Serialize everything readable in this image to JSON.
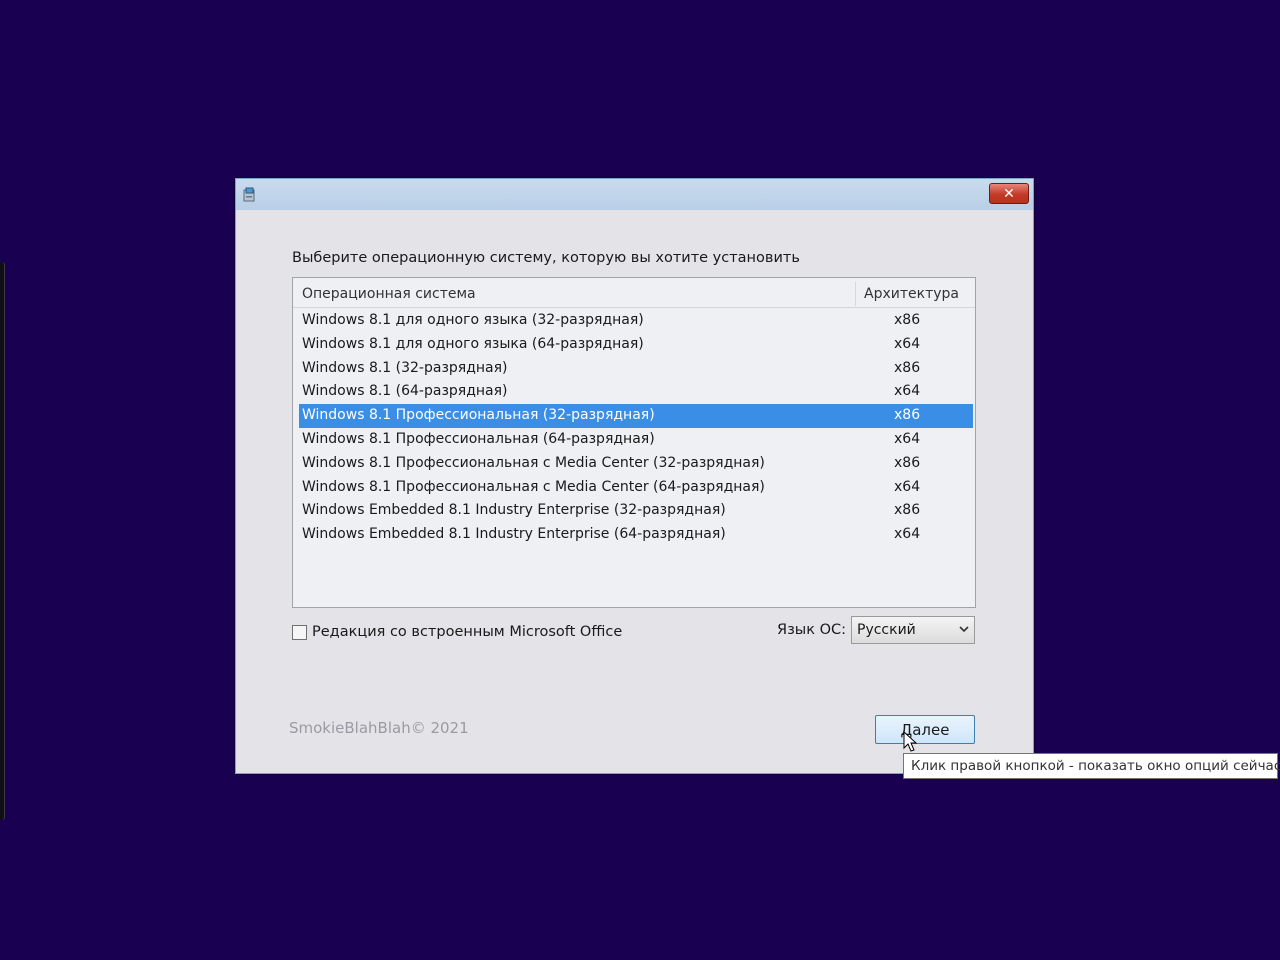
{
  "window": {
    "title": "",
    "close_symbol": "✕"
  },
  "prompt": "Выберите операционную систему, которую вы хотите установить",
  "listview": {
    "columns": [
      "Операционная система",
      "Архитектура"
    ],
    "rows": [
      {
        "name": "Windows 8.1 для одного языка (32-разрядная)",
        "arch": "x86",
        "selected": false
      },
      {
        "name": "Windows 8.1 для одного языка (64-разрядная)",
        "arch": "x64",
        "selected": false
      },
      {
        "name": "Windows 8.1 (32-разрядная)",
        "arch": "x86",
        "selected": false
      },
      {
        "name": "Windows 8.1 (64-разрядная)",
        "arch": "x64",
        "selected": false
      },
      {
        "name": "Windows 8.1 Профессиональная (32-разрядная)",
        "arch": "x86",
        "selected": true
      },
      {
        "name": "Windows 8.1 Профессиональная (64-разрядная)",
        "arch": "x64",
        "selected": false
      },
      {
        "name": "Windows 8.1 Профессиональная с Media Center (32-разрядная)",
        "arch": "x86",
        "selected": false
      },
      {
        "name": "Windows 8.1 Профессиональная с Media Center (64-разрядная)",
        "arch": "x64",
        "selected": false
      },
      {
        "name": "Windows Embedded 8.1 Industry Enterprise (32-разрядная)",
        "arch": "x86",
        "selected": false
      },
      {
        "name": "Windows Embedded 8.1 Industry Enterprise (64-разрядная)",
        "arch": "x64",
        "selected": false
      }
    ]
  },
  "office_checkbox": {
    "label": "Редакция со встроенным Microsoft Office",
    "checked": false
  },
  "language": {
    "label": "Язык ОС:",
    "selected": "Русский"
  },
  "copyright": "SmokieBlahBlah© 2021",
  "next_button": {
    "label": "Далее"
  },
  "tooltip": "Клик правой кнопкой - показать окно опций сейчас",
  "colors": {
    "desktop": "#1a0050",
    "selection": "#3a8ee6",
    "close_button": "#c23a28"
  },
  "icons": [
    "app-icon",
    "close-icon",
    "chevron-down-icon",
    "cursor-icon"
  ]
}
